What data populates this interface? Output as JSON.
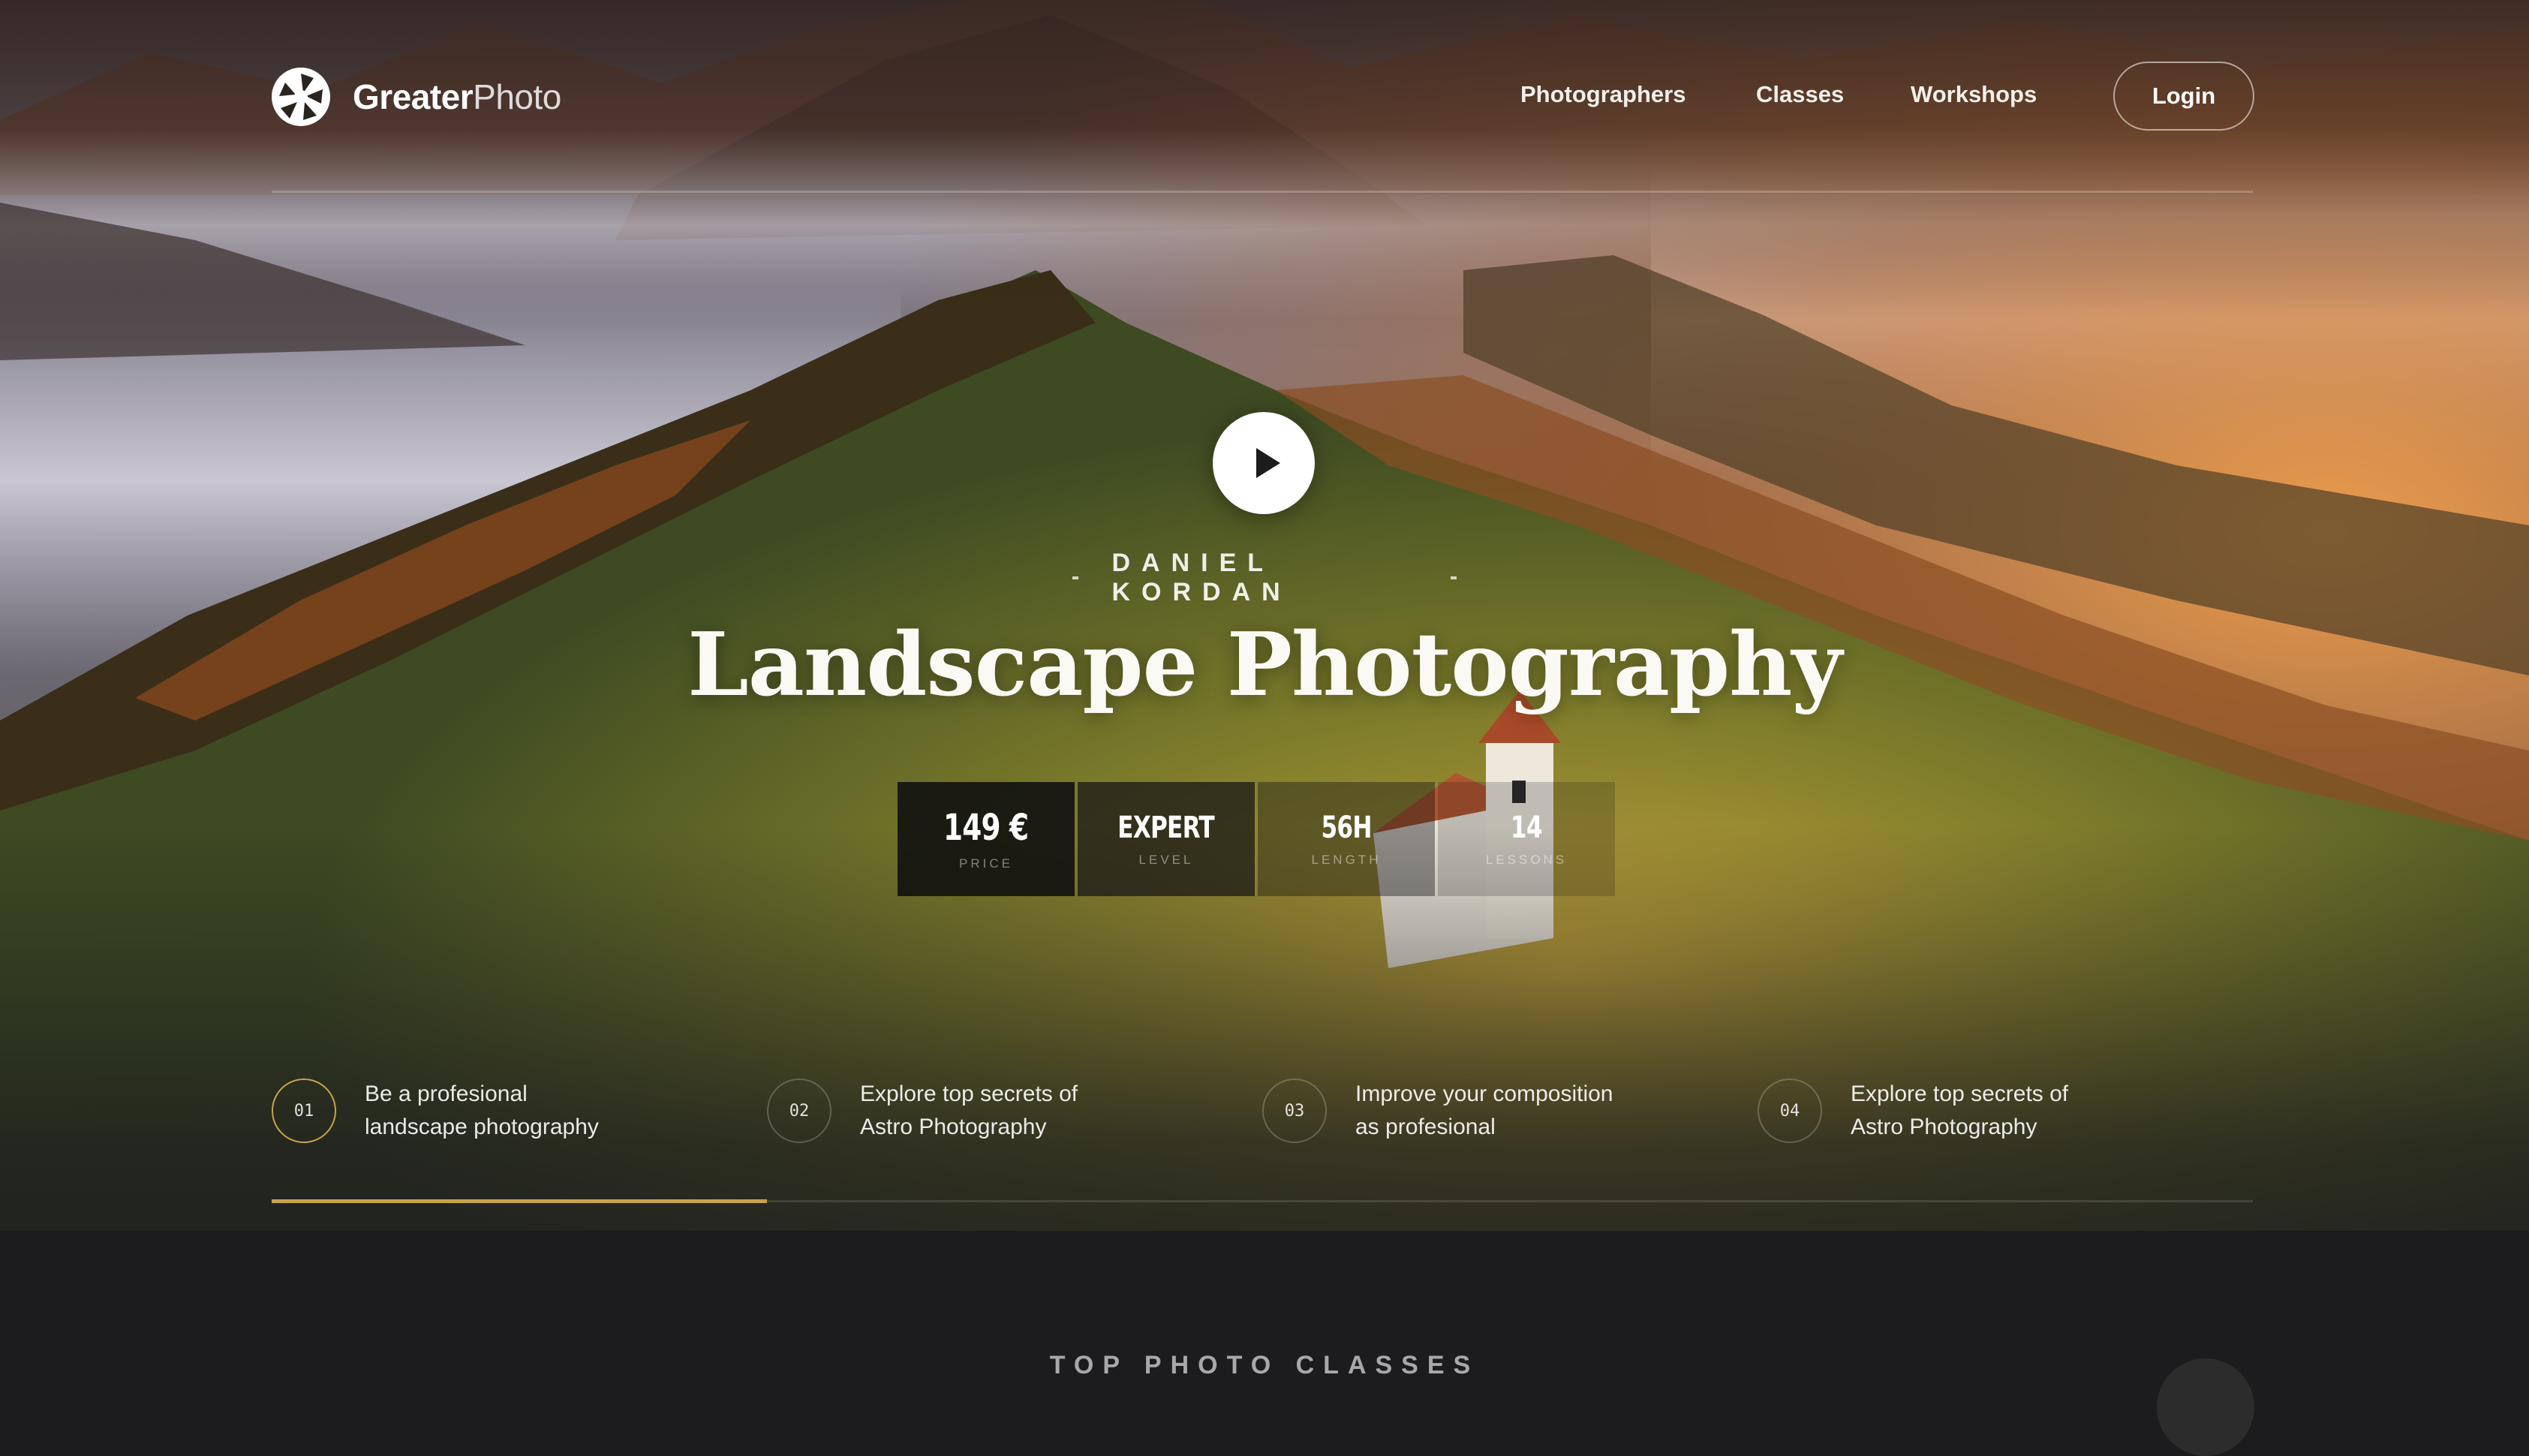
{
  "brand": {
    "name_bold": "Greater",
    "name_light": "Photo",
    "icon": "aperture-logo-icon"
  },
  "nav": {
    "items": [
      {
        "label": "Photographers"
      },
      {
        "label": "Classes"
      },
      {
        "label": "Workshops"
      }
    ],
    "login_label": "Login"
  },
  "hero": {
    "play_icon": "play-icon",
    "instructor": "DANIEL KORDAN",
    "title": "Landscape Photography",
    "stats": [
      {
        "value": "149 €",
        "label": "PRICE"
      },
      {
        "value": "EXPERT",
        "label": "LEVEL"
      },
      {
        "value": "56H",
        "label": "LENGTH"
      },
      {
        "value": "14",
        "label": "LESSONS"
      }
    ]
  },
  "features": [
    {
      "number": "01",
      "line1": "Be a profesional",
      "line2": "landscape photography"
    },
    {
      "number": "02",
      "line1": "Explore top secrets of",
      "line2": "Astro Photography"
    },
    {
      "number": "03",
      "line1": "Improve your composition",
      "line2": "as profesional"
    },
    {
      "number": "04",
      "line1": "Explore top secrets of",
      "line2": "Astro Photography"
    }
  ],
  "progress": {
    "active_index": 1,
    "fraction": 0.25
  },
  "section": {
    "heading": "TOP PHOTO CLASSES"
  },
  "colors": {
    "accent": "#c9a24a",
    "background": "#1c1c1e",
    "text": "#ffffff"
  }
}
